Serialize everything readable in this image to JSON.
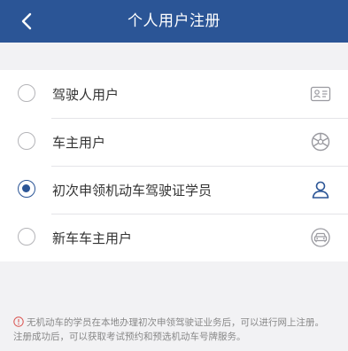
{
  "header": {
    "title": "个人用户注册"
  },
  "options": [
    {
      "label": "驾驶人用户",
      "icon": "id-card-icon",
      "checked": false
    },
    {
      "label": "车主用户",
      "icon": "steering-wheel-icon",
      "checked": false
    },
    {
      "label": "初次申领机动车驾驶证学员",
      "icon": "person-icon",
      "checked": true
    },
    {
      "label": "新车车主用户",
      "icon": "car-front-icon",
      "checked": false
    }
  ],
  "notice": {
    "text": "无机动车的学员在本地办理初次申领驾驶证业务后，可以进行网上注册。注册成功后，可以获取考试预约和预选机动车号牌服务。"
  },
  "colors": {
    "header_bg": "#2b5596",
    "accent": "#2b5596",
    "notice_icon": "#d9534f"
  }
}
